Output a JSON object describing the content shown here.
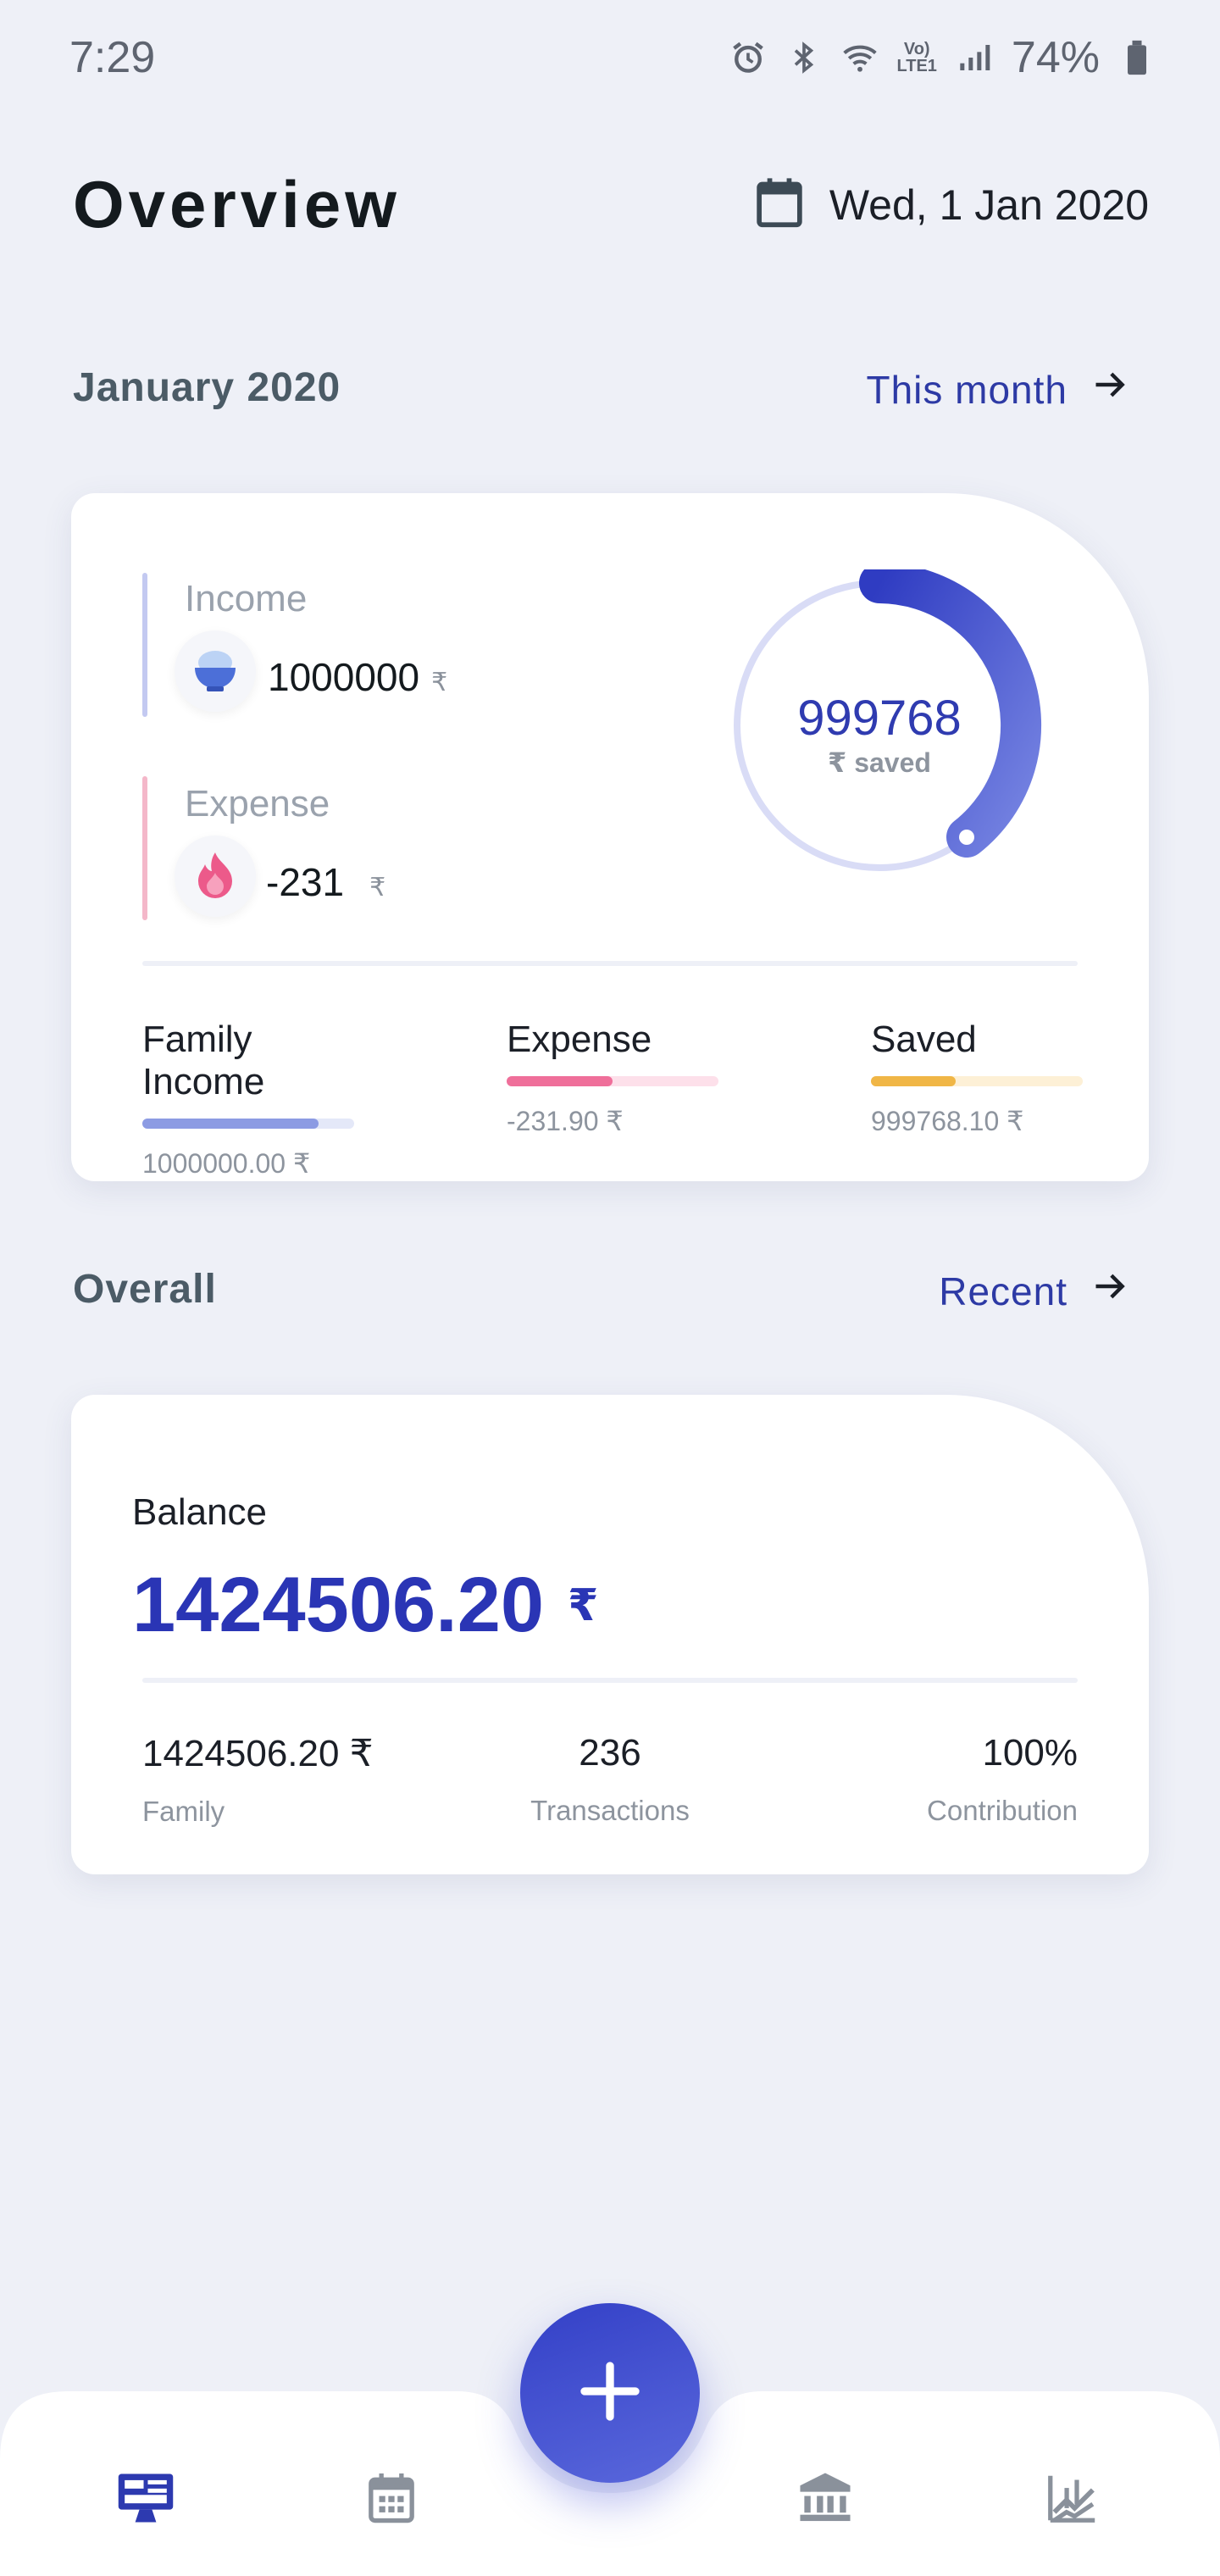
{
  "status_bar": {
    "time": "7:29",
    "volte": "Vo)\nLTE1",
    "battery": "74%"
  },
  "header": {
    "title": "Overview",
    "date": "Wed, 1 Jan 2020",
    "calendar_icon": "calendar-icon"
  },
  "month_section": {
    "title": "January 2020",
    "link_label": "This month",
    "income": {
      "label": "Income",
      "amount": "1000000",
      "currency": "₹"
    },
    "expense": {
      "label": "Expense",
      "amount": "-231",
      "currency": "₹"
    },
    "donut": {
      "value": "999768",
      "caption": "₹ saved",
      "fraction": 0.38
    },
    "stats": [
      {
        "label": "Family Income",
        "value": "1000000.00 ₹",
        "fill": 0.83,
        "color": "#8c9be3",
        "track": "#e4e8f8"
      },
      {
        "label": "Expense",
        "value": "-231.90 ₹",
        "fill": 0.5,
        "color": "#ef6f9a",
        "track": "#fde0ea"
      },
      {
        "label": "Saved",
        "value": "999768.10 ₹",
        "fill": 0.4,
        "color": "#f0b646",
        "track": "#fdf0d6"
      }
    ]
  },
  "overall_section": {
    "title": "Overall",
    "link_label": "Recent",
    "balance_label": "Balance",
    "balance_value": "1424506.20",
    "balance_currency": "₹",
    "stats": [
      {
        "value": "1424506.20 ₹",
        "caption": "Family"
      },
      {
        "value": "236",
        "caption": "Transactions"
      },
      {
        "value": "100%",
        "caption": "Contribution"
      }
    ]
  },
  "colors": {
    "accent": "#2d3aa5",
    "income_bar": "#c3c9f1",
    "expense_bar": "#f4b7c9",
    "background": "#eef0f7"
  },
  "bottom_nav": {
    "items": [
      "dashboard-icon",
      "calendar-grid-icon",
      "add-icon",
      "bank-icon",
      "stats-icon"
    ]
  }
}
